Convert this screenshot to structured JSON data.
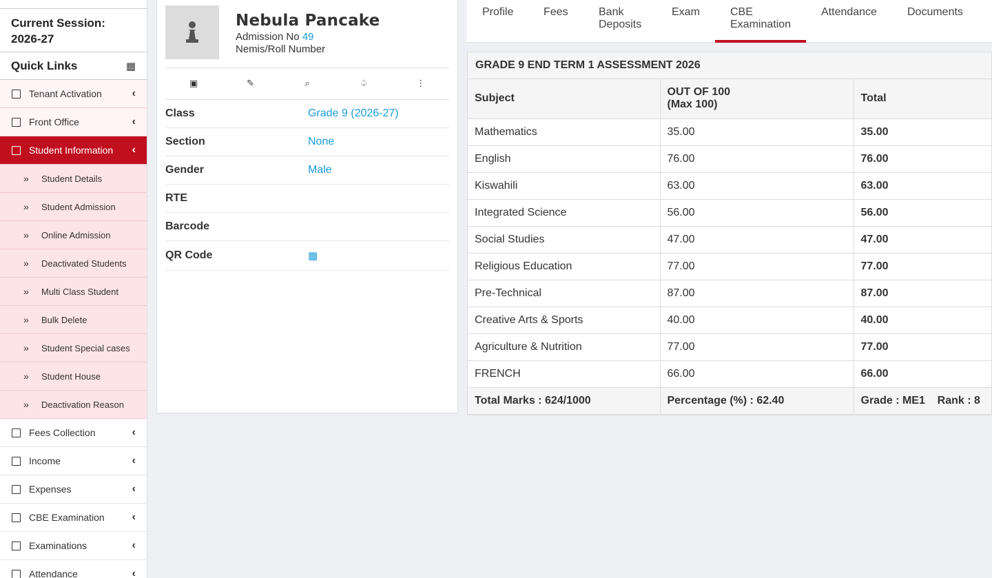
{
  "sidebar": {
    "session_title": "Current Session:",
    "session_year": "2026-27",
    "quick_links": "Quick Links",
    "menu_top": [
      {
        "label": "Tenant Activation"
      },
      {
        "label": "Front Office"
      }
    ],
    "active_menu": {
      "label": "Student Information"
    },
    "submenu": [
      {
        "label": "Student Details"
      },
      {
        "label": "Student Admission"
      },
      {
        "label": "Online Admission"
      },
      {
        "label": "Deactivated Students"
      },
      {
        "label": "Multi Class Student"
      },
      {
        "label": "Bulk Delete"
      },
      {
        "label": "Student Special cases"
      },
      {
        "label": "Student House"
      },
      {
        "label": "Deactivation Reason"
      }
    ],
    "menu_bottom": [
      {
        "label": "Fees Collection"
      },
      {
        "label": "Income"
      },
      {
        "label": "Expenses"
      },
      {
        "label": "CBE Examination"
      },
      {
        "label": "Examinations"
      },
      {
        "label": "Attendance"
      }
    ]
  },
  "profile": {
    "name": "Nebula Pancake",
    "admission_label": "Admission No",
    "admission_no": "49",
    "nemis_label": "Nemis/Roll Number",
    "actions": [
      "edit-card-icon",
      "pencil-icon",
      "search-icon",
      "spade-icon",
      "more-vertical-icon"
    ],
    "fields": [
      {
        "key": "Class",
        "value": "Grade 9 (2026-27)"
      },
      {
        "key": "Section",
        "value": "None"
      },
      {
        "key": "Gender",
        "value": "Male"
      },
      {
        "key": "RTE",
        "value": ""
      },
      {
        "key": "Barcode",
        "value": ""
      },
      {
        "key": "QR Code",
        "value": "▦"
      }
    ]
  },
  "tabs": [
    {
      "label": "Profile"
    },
    {
      "label": "Fees"
    },
    {
      "label": "Bank\nDeposits"
    },
    {
      "label": "Exam"
    },
    {
      "label": "CBE\nExamination"
    },
    {
      "label": "Attendance"
    },
    {
      "label": "Documents"
    }
  ],
  "active_tab": "CBE Examination",
  "results": {
    "title": "GRADE 9 END TERM 1 ASSESSMENT 2026",
    "headers": [
      "Subject",
      "OUT OF 100\n(Max 100)",
      "Total"
    ],
    "rows": [
      {
        "subject": "Mathematics",
        "score": "35.00",
        "total": "35.00"
      },
      {
        "subject": "English",
        "score": "76.00",
        "total": "76.00"
      },
      {
        "subject": "Kiswahili",
        "score": "63.00",
        "total": "63.00"
      },
      {
        "subject": "Integrated Science",
        "score": "56.00",
        "total": "56.00"
      },
      {
        "subject": "Social Studies",
        "score": "47.00",
        "total": "47.00"
      },
      {
        "subject": "Religious Education",
        "score": "77.00",
        "total": "77.00"
      },
      {
        "subject": "Pre-Technical",
        "score": "87.00",
        "total": "87.00"
      },
      {
        "subject": "Creative Arts & Sports",
        "score": "40.00",
        "total": "40.00"
      },
      {
        "subject": "Agriculture & Nutrition",
        "score": "77.00",
        "total": "77.00"
      },
      {
        "subject": "FRENCH",
        "score": "66.00",
        "total": "66.00"
      }
    ],
    "summary": {
      "total_marks": "Total Marks : 624/1000",
      "percentage": "Percentage (%) : 62.40",
      "grade": "Grade : ME1",
      "rank": "Rank : 8"
    }
  },
  "colors": {
    "accent": "#c0101f",
    "link": "#1a9bd7",
    "submenu_bg": "#fde4e6"
  }
}
